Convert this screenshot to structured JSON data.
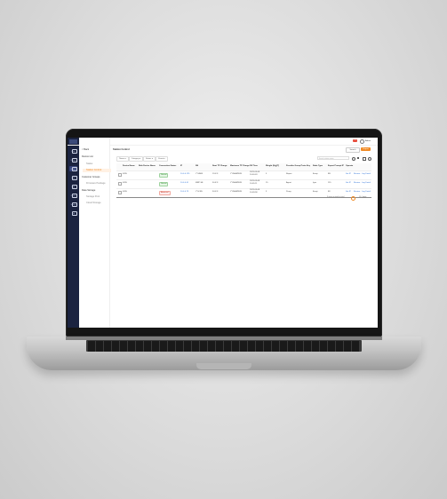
{
  "app": {
    "title": "HANSUS",
    "nav": [
      {
        "label": "Home"
      },
      {
        "label": "Devices"
      },
      {
        "label": "Network"
      },
      {
        "label": "Users"
      },
      {
        "label": "Logs"
      },
      {
        "label": "Reports"
      },
      {
        "label": "Settings"
      },
      {
        "label": "Help"
      }
    ],
    "submenu": {
      "back_label": "< Back",
      "items": [
        "Device List",
        "Status",
        "Station Control",
        "Customer Groups",
        "Firmware Package",
        "Data Storage",
        "Storage Pool",
        "Cloud Storage"
      ]
    },
    "header": {
      "alert_count": "12",
      "user": "Admin"
    },
    "page": {
      "title": "Station Control",
      "search_label": "Search",
      "export_label": "Export",
      "filters": [
        "Name ▾",
        "Category ▾",
        "Status ▾",
        "Event ▾"
      ],
      "table_search_placeholder": "Search station name"
    },
    "table": {
      "columns": [
        "Device Name",
        "Nick Device Name",
        "Connection Status",
        "IP",
        "SN",
        "Start TP Charge",
        "Maximum TP Charge",
        "Fill Time",
        "Weight (Kg)(T)",
        "Provider Group Proto Key",
        "Node Type",
        "Export Prompt IP",
        "Operate"
      ],
      "rows": [
        {
          "name": "4265",
          "nick": "",
          "status": "Normal",
          "ip": "10.0.0.125",
          "sn": "YYVA35",
          "start": "19.0°F",
          "max": "YYZA4MWW",
          "time": "2023-03-08 10:00:43",
          "weight": "5",
          "group": "Repair",
          "type": "Emoji",
          "prompt": "8B",
          "ops": [
            "Set IP",
            "Review",
            "Log Detail"
          ]
        },
        {
          "name": "4265",
          "nick": "",
          "status": "Normal",
          "ip": "10.0.0.41",
          "sn": "MRP-SE",
          "start": "50.6°F",
          "max": "YYZA4MWW",
          "time": "2023-03-08 10:05:11",
          "weight": "15",
          "group": "Agent",
          "type": "Igris",
          "prompt": "115",
          "ops": [
            "Set IP",
            "Review",
            "Log Detail"
          ]
        },
        {
          "name": "4265",
          "nick": "",
          "status": "Abnormal",
          "ip": "10.0.0.73",
          "sn": "YYV-B5",
          "start": "34.0°F",
          "max": "YYZA4MWW",
          "time": "2023-03-08 10:09:58",
          "weight": "3",
          "group": "Proxy",
          "type": "Emoji",
          "prompt": "88",
          "ops": [
            "Set IP",
            "Review",
            "Log Detail"
          ]
        }
      ]
    },
    "pagination": {
      "summary": "3 items in total in total",
      "page": "1",
      "per_page": "10 / page"
    },
    "colors": {
      "nav_bg": "#1b2340",
      "accent": "#f08a24",
      "link": "#2a6fd6",
      "ok": "#3a8a3a",
      "bad": "#c0392b"
    }
  }
}
